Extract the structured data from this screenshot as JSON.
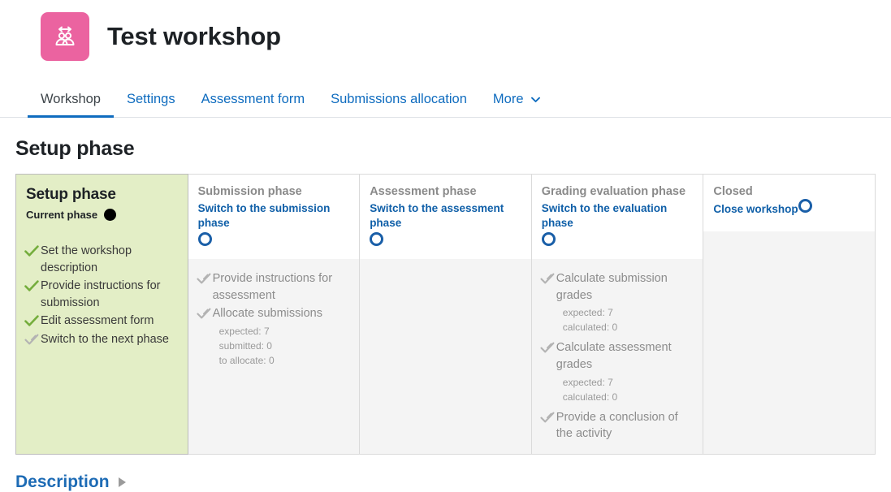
{
  "header": {
    "title": "Test workshop",
    "icon": "workshop-people-arrow-icon"
  },
  "tabs": [
    {
      "label": "Workshop",
      "active": true
    },
    {
      "label": "Settings",
      "active": false
    },
    {
      "label": "Assessment form",
      "active": false
    },
    {
      "label": "Submissions allocation",
      "active": false
    },
    {
      "label": "More",
      "active": false,
      "caret": "⌄"
    }
  ],
  "section": {
    "title": "Setup phase"
  },
  "phases": [
    {
      "name": "Setup phase",
      "current": true,
      "current_label": "Current phase",
      "switch_link": null,
      "tasks": [
        {
          "text": "Set the workshop description",
          "state": "done",
          "details": []
        },
        {
          "text": "Provide instructions for submission",
          "state": "done",
          "details": []
        },
        {
          "text": "Edit assessment form",
          "state": "done",
          "details": []
        },
        {
          "text": "Switch to the next phase",
          "state": "todo",
          "details": []
        }
      ]
    },
    {
      "name": "Submission phase",
      "current": false,
      "switch_link": "Switch to the submission phase",
      "link_inline": false,
      "tasks": [
        {
          "text": "Provide instructions for assessment",
          "state": "todo",
          "details": []
        },
        {
          "text": "Allocate submissions",
          "state": "todo",
          "details": [
            "expected: 7",
            "submitted: 0",
            "to allocate: 0"
          ]
        }
      ]
    },
    {
      "name": "Assessment phase",
      "current": false,
      "switch_link": "Switch to the assessment phase",
      "link_inline": false,
      "tasks": []
    },
    {
      "name": "Grading evaluation phase",
      "current": false,
      "switch_link": "Switch to the evaluation phase",
      "link_inline": false,
      "tasks": [
        {
          "text": "Calculate submission grades",
          "state": "todo",
          "details": [
            "expected: 7",
            "calculated: 0"
          ]
        },
        {
          "text": "Calculate assessment grades",
          "state": "todo",
          "details": [
            "expected: 7",
            "calculated: 0"
          ]
        },
        {
          "text": "Provide a conclusion of the activity",
          "state": "todo",
          "details": []
        }
      ]
    },
    {
      "name": "Closed",
      "current": false,
      "switch_link": "Close workshop",
      "link_inline": true,
      "tasks": []
    }
  ],
  "description": {
    "title": "Description",
    "toggle_icon": "triangle-right-icon"
  },
  "colors": {
    "brand_blue": "#0f6cbf",
    "link_blue": "#0f5fa8",
    "icon_pink": "#eb63a0",
    "current_phase_bg": "#e3eec6",
    "inactive_body_bg": "#f4f4f4",
    "check_green": "#74ad3c"
  }
}
